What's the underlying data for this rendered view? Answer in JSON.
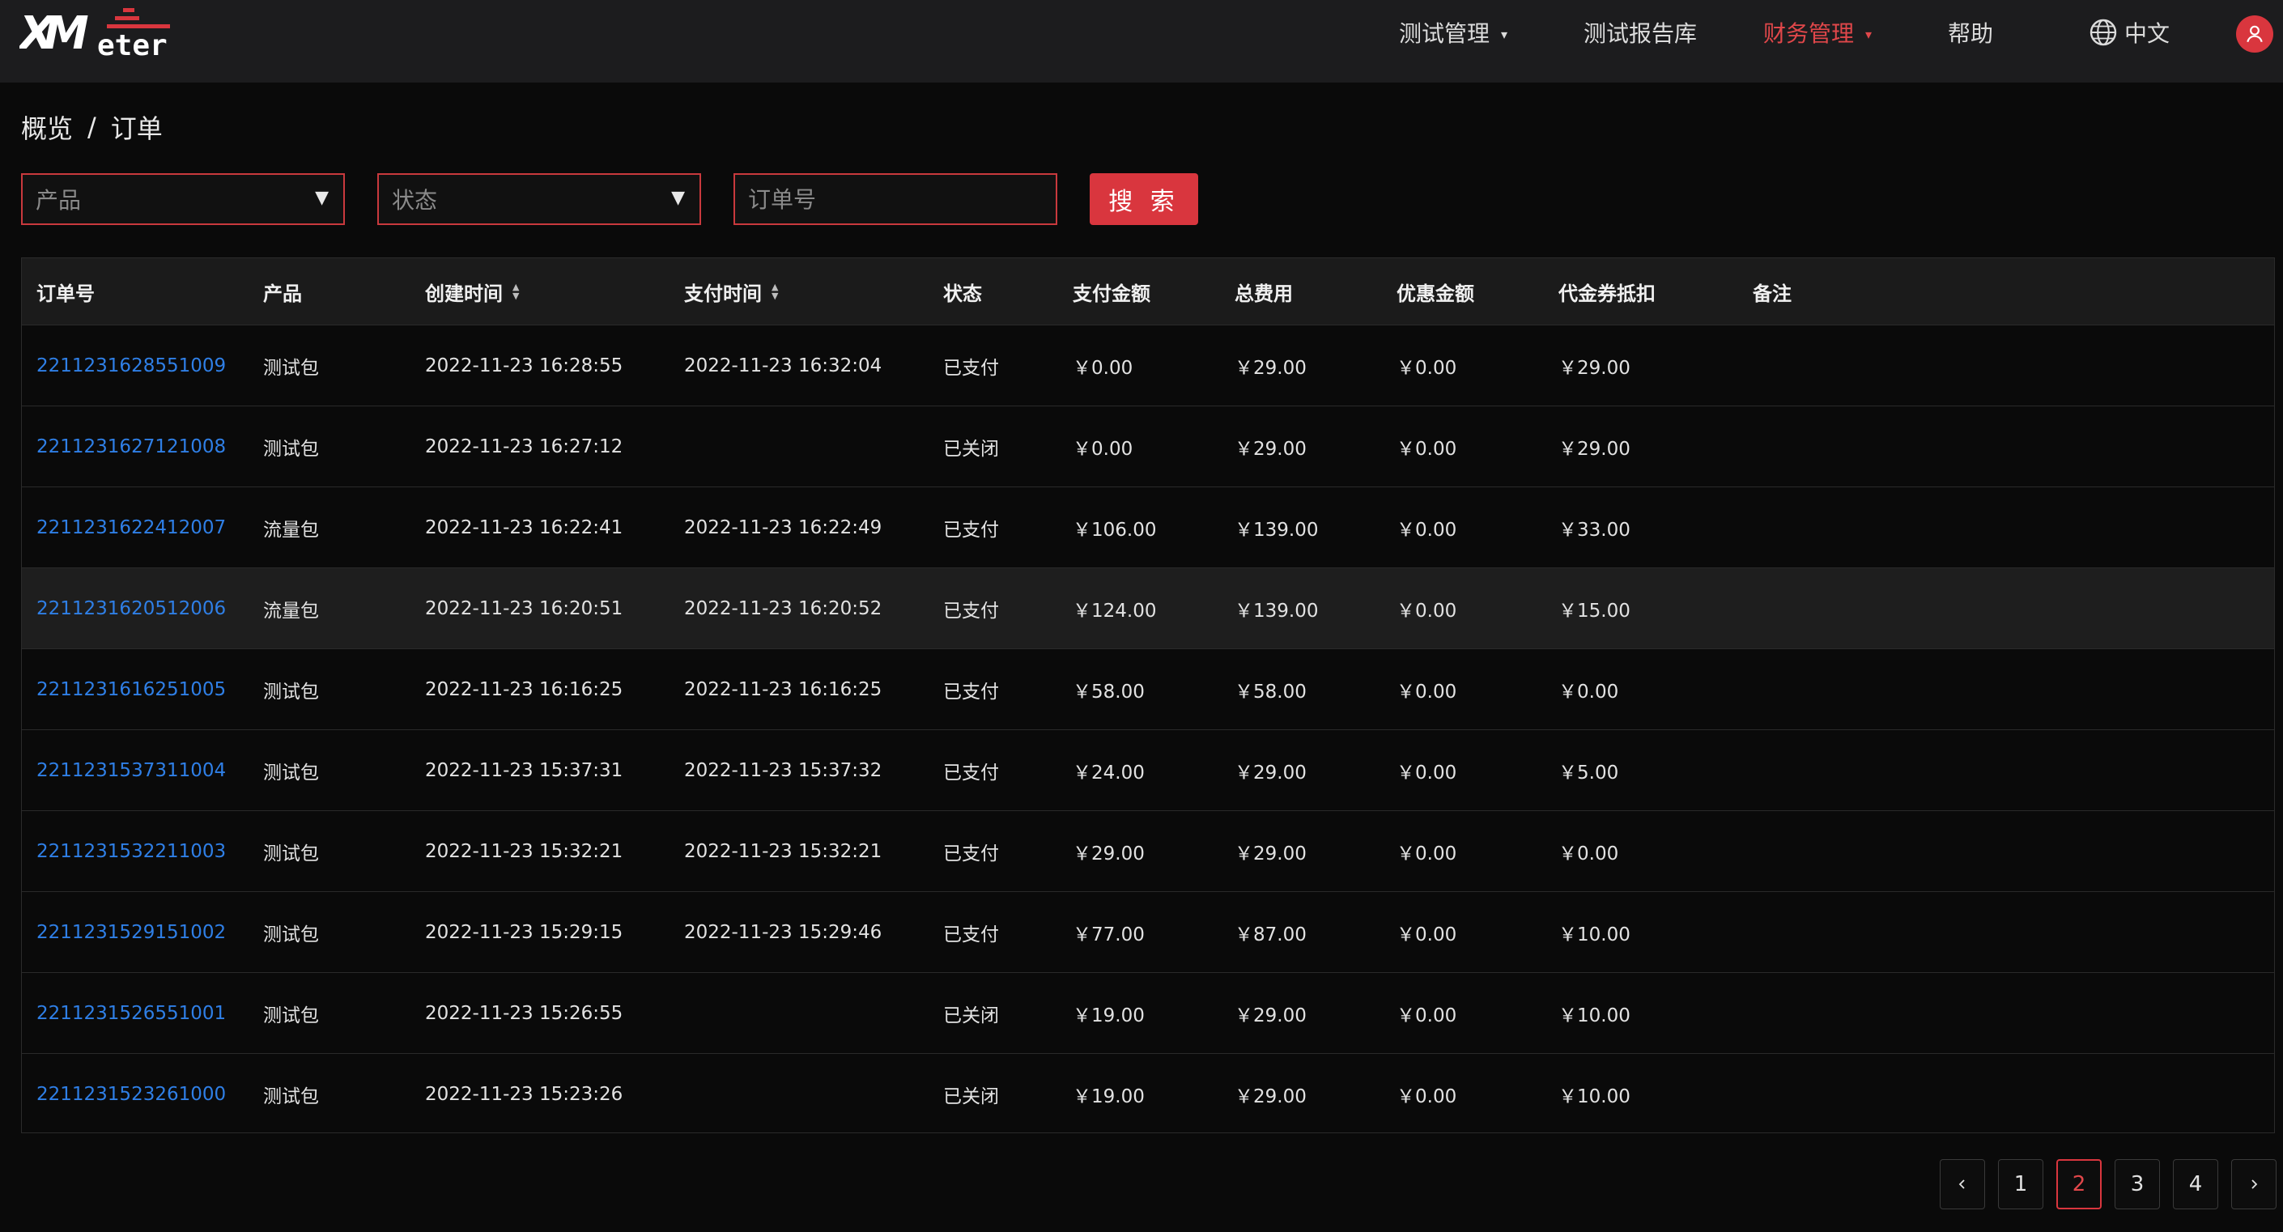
{
  "brand": {
    "logo_text": "XMeter",
    "accent": "#d9363e",
    "link": "#2f7fe6"
  },
  "nav": {
    "items": [
      {
        "label": "测试管理",
        "has_dropdown": true,
        "active": false
      },
      {
        "label": "测试报告库",
        "has_dropdown": false,
        "active": false
      },
      {
        "label": "财务管理",
        "has_dropdown": true,
        "active": true
      },
      {
        "label": "帮助",
        "has_dropdown": false,
        "active": false
      }
    ],
    "language": "中文",
    "globe_icon": "globe-icon",
    "user_icon": "user-icon"
  },
  "breadcrumb": {
    "parent": "概览",
    "separator": "/",
    "current": "订单"
  },
  "filters": {
    "product_placeholder": "产品",
    "status_placeholder": "状态",
    "order_placeholder": "订单号",
    "search_label": "搜 索"
  },
  "table": {
    "columns": [
      "订单号",
      "产品",
      "创建时间",
      "支付时间",
      "状态",
      "支付金额",
      "总费用",
      "优惠金额",
      "代金券抵扣",
      "备注"
    ],
    "sortable": [
      "创建时间",
      "支付时间"
    ],
    "rows": [
      [
        "2211231628551009",
        "测试包",
        "2022-11-23 16:28:55",
        "2022-11-23 16:32:04",
        "已支付",
        "￥0.00",
        "￥29.00",
        "￥0.00",
        "￥29.00",
        ""
      ],
      [
        "2211231627121008",
        "测试包",
        "2022-11-23 16:27:12",
        "",
        "已关闭",
        "￥0.00",
        "￥29.00",
        "￥0.00",
        "￥29.00",
        ""
      ],
      [
        "2211231622412007",
        "流量包",
        "2022-11-23 16:22:41",
        "2022-11-23 16:22:49",
        "已支付",
        "￥106.00",
        "￥139.00",
        "￥0.00",
        "￥33.00",
        ""
      ],
      [
        "2211231620512006",
        "流量包",
        "2022-11-23 16:20:51",
        "2022-11-23 16:20:52",
        "已支付",
        "￥124.00",
        "￥139.00",
        "￥0.00",
        "￥15.00",
        ""
      ],
      [
        "2211231616251005",
        "测试包",
        "2022-11-23 16:16:25",
        "2022-11-23 16:16:25",
        "已支付",
        "￥58.00",
        "￥58.00",
        "￥0.00",
        "￥0.00",
        ""
      ],
      [
        "2211231537311004",
        "测试包",
        "2022-11-23 15:37:31",
        "2022-11-23 15:37:32",
        "已支付",
        "￥24.00",
        "￥29.00",
        "￥0.00",
        "￥5.00",
        ""
      ],
      [
        "2211231532211003",
        "测试包",
        "2022-11-23 15:32:21",
        "2022-11-23 15:32:21",
        "已支付",
        "￥29.00",
        "￥29.00",
        "￥0.00",
        "￥0.00",
        ""
      ],
      [
        "2211231529151002",
        "测试包",
        "2022-11-23 15:29:15",
        "2022-11-23 15:29:46",
        "已支付",
        "￥77.00",
        "￥87.00",
        "￥0.00",
        "￥10.00",
        ""
      ],
      [
        "2211231526551001",
        "测试包",
        "2022-11-23 15:26:55",
        "",
        "已关闭",
        "￥19.00",
        "￥29.00",
        "￥0.00",
        "￥10.00",
        ""
      ],
      [
        "2211231523261000",
        "测试包",
        "2022-11-23 15:23:26",
        "",
        "已关闭",
        "￥19.00",
        "￥29.00",
        "￥0.00",
        "￥10.00",
        ""
      ]
    ],
    "highlighted_row": 3
  },
  "pagination": {
    "pages": [
      "1",
      "2",
      "3",
      "4"
    ],
    "current": "2",
    "prev_icon": "chevron-left-icon",
    "next_icon": "chevron-right-icon"
  }
}
